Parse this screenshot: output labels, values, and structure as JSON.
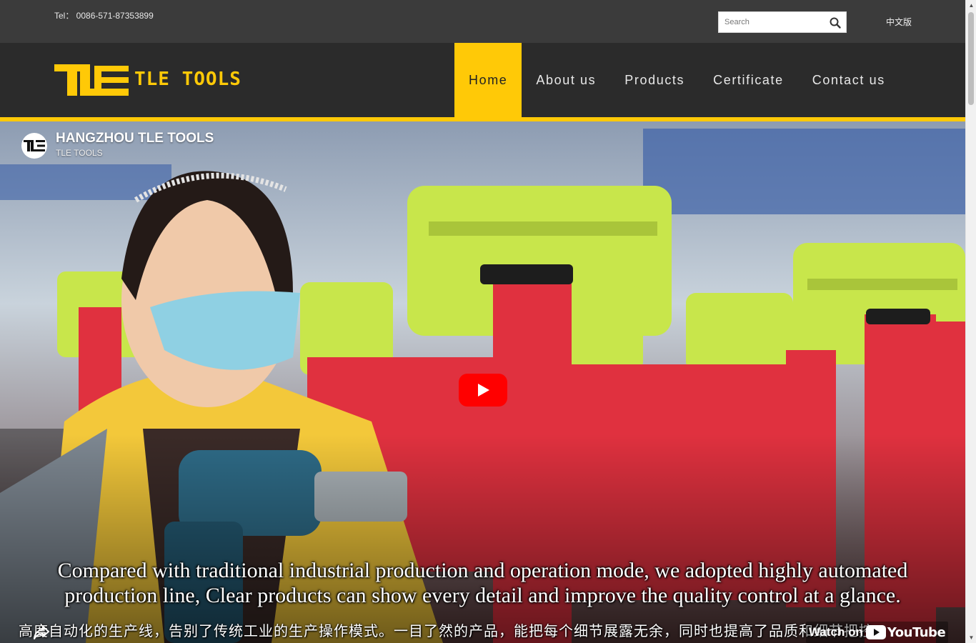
{
  "header": {
    "tel": "Tel： 0086-571-87353899",
    "search_placeholder": "Search",
    "search_icon": "search-icon",
    "language": "中文版"
  },
  "logo": {
    "mark": "TLE",
    "text": "TLE TOOLS"
  },
  "nav": {
    "items": [
      {
        "label": "Home",
        "active": true
      },
      {
        "label": "About us",
        "active": false
      },
      {
        "label": "Products",
        "active": false
      },
      {
        "label": "Certificate",
        "active": false
      },
      {
        "label": "Contact us",
        "active": false
      }
    ]
  },
  "video": {
    "channel_name": "HANGZHOU TLE TOOLS",
    "channel_sub": "TLE TOOLS",
    "channel_avatar_text": "TLE",
    "subtitle_line1": "Compared with traditional industrial production and operation mode, we adopted highly automated",
    "subtitle_line2": "production line, Clear products can show every detail and improve the quality control at a glance.",
    "subtitle_zh": "高度自动化的生产线，告别了传统工业的生产操作模式。一目了然的产品，能把每个细节展露无余，同时也提高了品质和细节把控。",
    "watch_on": "Watch on",
    "youtube_word": "YouTube",
    "icons": [
      "play-icon",
      "share-icon",
      "youtube-icon"
    ]
  },
  "colors": {
    "accent": "#ffc907",
    "topbar": "#3b3b3b",
    "navbar": "#2b2b2b",
    "youtube_red": "#ff0000"
  }
}
